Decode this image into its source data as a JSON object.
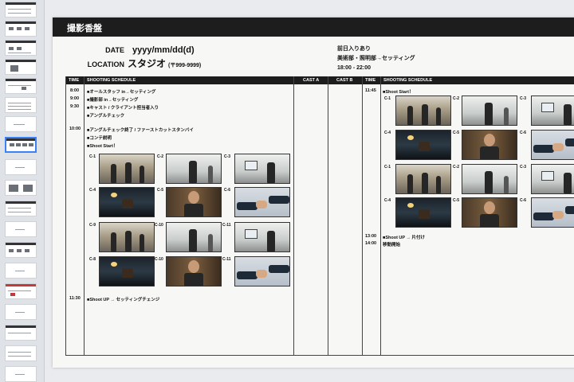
{
  "slide": {
    "title": "撮影香盤",
    "date_label": "DATE",
    "date_value": "yyyy/mm/dd(d)",
    "location_label": "LOCATION",
    "location_value": "スタジオ",
    "location_postal": "(〒999-9999)",
    "notes": [
      "前日入りあり",
      "美術部・照明部→セッティング",
      "18:00 - 22:00"
    ]
  },
  "table": {
    "headers": {
      "time": "TIME",
      "schedule": "SHOOTING SCHEDULE",
      "cast_a": "CAST A",
      "cast_b": "CAST B",
      "time2": "TIME",
      "schedule2": "SHOOTING SCHEDULE"
    },
    "left": {
      "times": [
        "8:00",
        "9:00",
        "9:30",
        "10:00",
        "11:30"
      ],
      "tasks": [
        "■オールスタッフ in→セッティング",
        "■撮影部 in→セッティング",
        "■キャスト / クライアント担当者入り",
        "■アングルチェック",
        "■アングルチェック終了 / ファーストカットスタンバイ",
        "■コンテ説明",
        "■Shoot Start！",
        "■Shoot UP → セッティングチェンジ"
      ],
      "cut_labels": [
        "C-1",
        "C-2",
        "C-3",
        "C-4",
        "C-5",
        "C-6",
        "C-9",
        "C-10",
        "C-11",
        "C-8",
        "C-10",
        "C-11"
      ]
    },
    "right": {
      "times": [
        "11:45",
        "13:00",
        "14:00"
      ],
      "tasks": [
        "■Shoot Start！",
        "■Shoot UP → 片付け",
        "移動開始"
      ],
      "cut_labels": [
        "C-1",
        "C-2",
        "C-3",
        "C-4",
        "C-5",
        "C-6",
        "C-1",
        "C-2",
        "C-3",
        "C-4",
        "C-5",
        "C-6"
      ]
    }
  }
}
